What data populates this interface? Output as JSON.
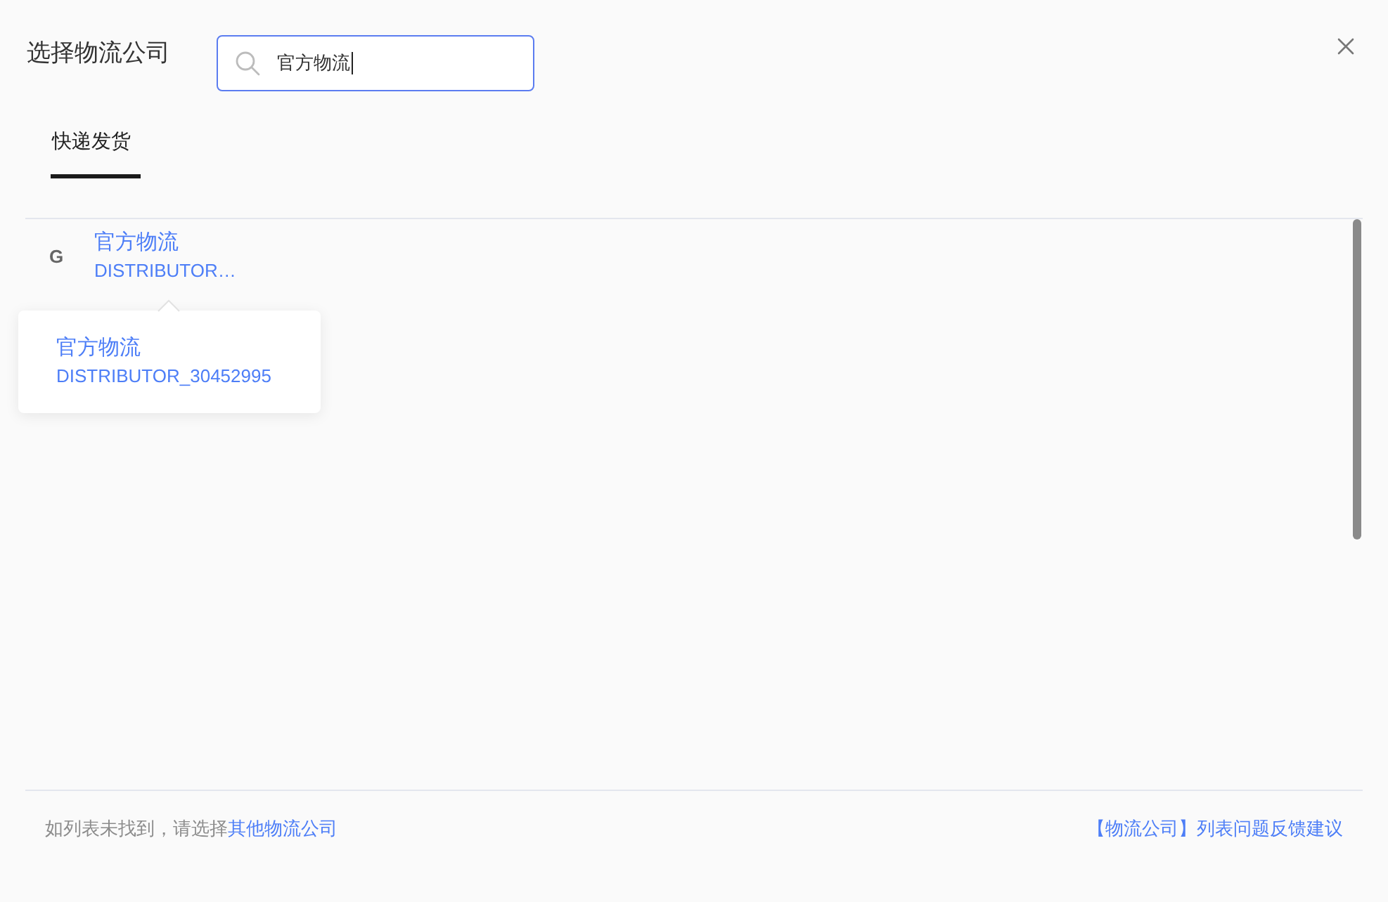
{
  "dialog": {
    "title": "选择物流公司"
  },
  "search": {
    "value": "官方物流"
  },
  "tabs": [
    {
      "label": "快递发货",
      "selected": true
    }
  ],
  "groups": [
    {
      "letter": "G",
      "items": [
        {
          "name": "官方物流",
          "code": "DISTRIBUTOR…"
        }
      ]
    }
  ],
  "tooltip": {
    "name": "官方物流",
    "code": "DISTRIBUTOR_30452995"
  },
  "footer": {
    "prompt": "如列表未找到，请选择",
    "link": "其他物流公司",
    "feedback": "【物流公司】列表问题反馈建议"
  }
}
